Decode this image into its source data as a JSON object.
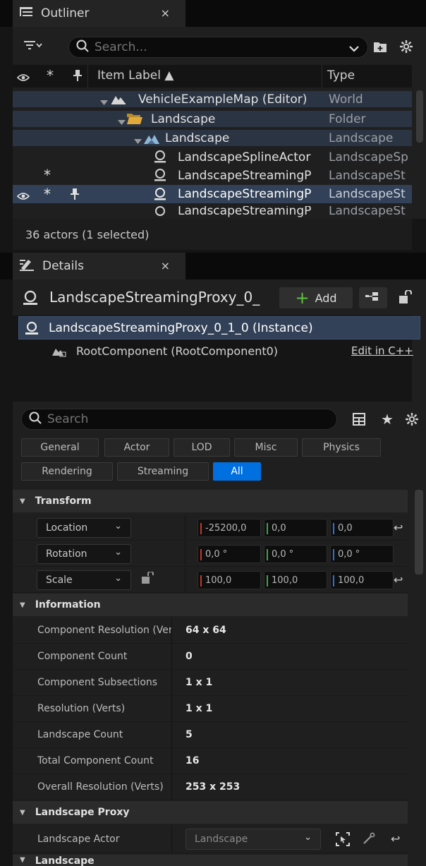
{
  "outliner": {
    "tab_title": "Outliner",
    "tab_close": "×",
    "search_placeholder": "Search...",
    "columns": {
      "item_label": "Item Label ▲",
      "type": "Type"
    },
    "rows": [
      {
        "label": "VehicleExampleMap (Editor)",
        "type": "World"
      },
      {
        "label": "Landscape",
        "type": "Folder"
      },
      {
        "label": "Landscape",
        "type": "Landscape"
      },
      {
        "label": "LandscapeSplineActor",
        "type": "LandscapeSp"
      },
      {
        "label": "LandscapeStreamingP",
        "type": "LandscapeSt"
      },
      {
        "label": "LandscapeStreamingP",
        "type": "LandscapeSt"
      },
      {
        "label": "LandscapeStreamingP",
        "type": "LandscapeSt"
      }
    ],
    "status": "36 actors (1 selected)"
  },
  "details": {
    "tab_title": "Details",
    "tab_close": "×",
    "actor_name": "LandscapeStreamingProxy_0_",
    "add_label": "Add",
    "instance_label": "LandscapeStreamingProxy_0_1_0 (Instance)",
    "root_component": "RootComponent (RootComponent0)",
    "edit_cpp": "Edit in C++",
    "search_placeholder": "Search",
    "categories": {
      "general": "General",
      "actor": "Actor",
      "lod": "LOD",
      "misc": "Misc",
      "physics": "Physics",
      "rendering": "Rendering",
      "streaming": "Streaming",
      "all": "All"
    },
    "transform": {
      "title": "Transform",
      "location_label": "Location",
      "rotation_label": "Rotation",
      "scale_label": "Scale",
      "location": [
        "-25200,0",
        "0,0",
        "0,0"
      ],
      "rotation": [
        "0,0 °",
        "0,0 °",
        "0,0 °"
      ],
      "scale": [
        "100,0",
        "100,0",
        "100,0"
      ]
    },
    "information": {
      "title": "Information",
      "props": [
        {
          "name": "Component Resolution (Verts)",
          "value": "64 x 64"
        },
        {
          "name": "Component Count",
          "value": "0"
        },
        {
          "name": "Component Subsections",
          "value": "1 x 1"
        },
        {
          "name": "Resolution (Verts)",
          "value": "1 x 1"
        },
        {
          "name": "Landscape Count",
          "value": "5"
        },
        {
          "name": "Total Component Count",
          "value": "16"
        },
        {
          "name": "Overall Resolution (Verts)",
          "value": "253 x 253"
        }
      ]
    },
    "landscape_proxy": {
      "title": "Landscape Proxy",
      "actor_label": "Landscape Actor",
      "actor_value": "Landscape"
    },
    "landscape": {
      "title": "Landscape"
    }
  },
  "colors": {
    "accent": "#0070e0",
    "selected_row": "#324157",
    "x_axis": "#c0392b",
    "y_axis": "#3fa34d",
    "z_axis": "#2f6fd6"
  }
}
